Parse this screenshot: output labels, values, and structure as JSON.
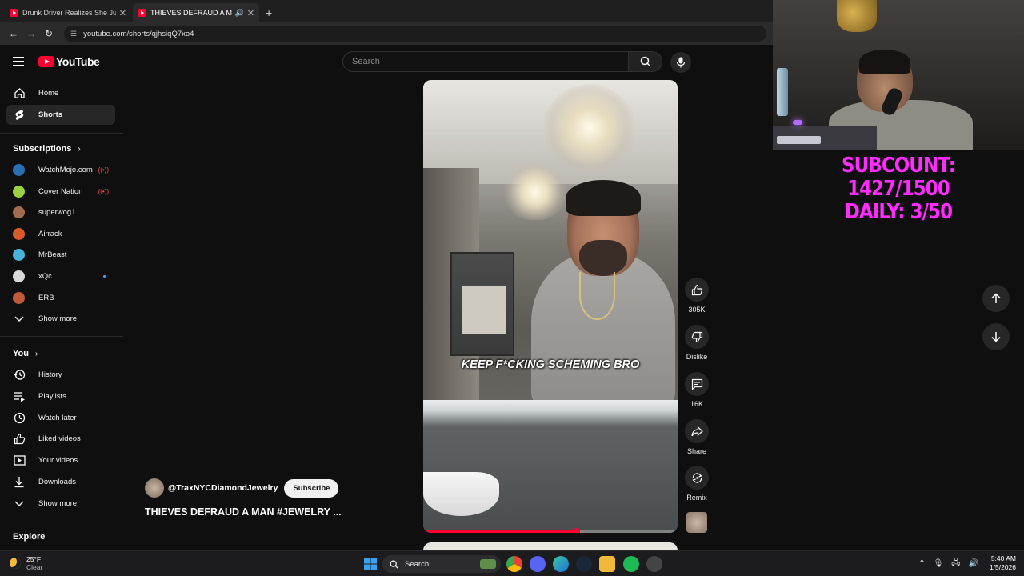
{
  "browser": {
    "tabs": [
      {
        "title": "Drunk Driver Realizes She Just",
        "active": false,
        "audio": false
      },
      {
        "title": "THIEVES DEFRAUD A MAN",
        "active": true,
        "audio": true
      }
    ],
    "url": "youtube.com/shorts/qjhsiqQ7xo4"
  },
  "header": {
    "logo_text": "YouTube",
    "search_placeholder": "Search"
  },
  "sidebar": {
    "main": [
      {
        "label": "Home",
        "icon": "home-icon"
      },
      {
        "label": "Shorts",
        "icon": "shorts-icon",
        "active": true
      }
    ],
    "subscriptions_title": "Subscriptions",
    "subscriptions": [
      {
        "label": "WatchMojo.com",
        "color": "#2a6fb5",
        "live": true
      },
      {
        "label": "Cover Nation",
        "color": "#9bd13f",
        "live": true
      },
      {
        "label": "superwog1",
        "color": "#a06b4e"
      },
      {
        "label": "Airrack",
        "color": "#d95a2b"
      },
      {
        "label": "MrBeast",
        "color": "#47b5d8"
      },
      {
        "label": "xQc",
        "color": "#d8d8d8",
        "new": true
      },
      {
        "label": "ERB",
        "color": "#c25a3a"
      }
    ],
    "subs_show_more": "Show more",
    "you_title": "You",
    "you_items": [
      {
        "label": "History",
        "icon": "history-icon"
      },
      {
        "label": "Playlists",
        "icon": "playlists-icon"
      },
      {
        "label": "Watch later",
        "icon": "watch-later-icon"
      },
      {
        "label": "Liked videos",
        "icon": "liked-videos-icon"
      },
      {
        "label": "Your videos",
        "icon": "your-videos-icon"
      },
      {
        "label": "Downloads",
        "icon": "downloads-icon"
      }
    ],
    "you_show_more": "Show more",
    "explore_title": "Explore"
  },
  "short": {
    "caption": "KEEP F*CKING SCHEMING BRO",
    "progress": 0.6,
    "channel": "@TraxNYCDiamondJewelry",
    "subscribe_label": "Subscribe",
    "title": "THIEVES DEFRAUD A MAN #JEWELRY ...",
    "actions": {
      "likes": "305K",
      "dislike": "Dislike",
      "comments": "16K",
      "share": "Share",
      "remix": "Remix"
    }
  },
  "overlay": {
    "line1": "SUBCOUNT: 1427/1500",
    "line2": "DAILY: 3/50"
  },
  "taskbar": {
    "temp": "25°F",
    "condition": "Clear",
    "search": "Search",
    "time": "5:40 AM",
    "date": "1/5/2026"
  }
}
